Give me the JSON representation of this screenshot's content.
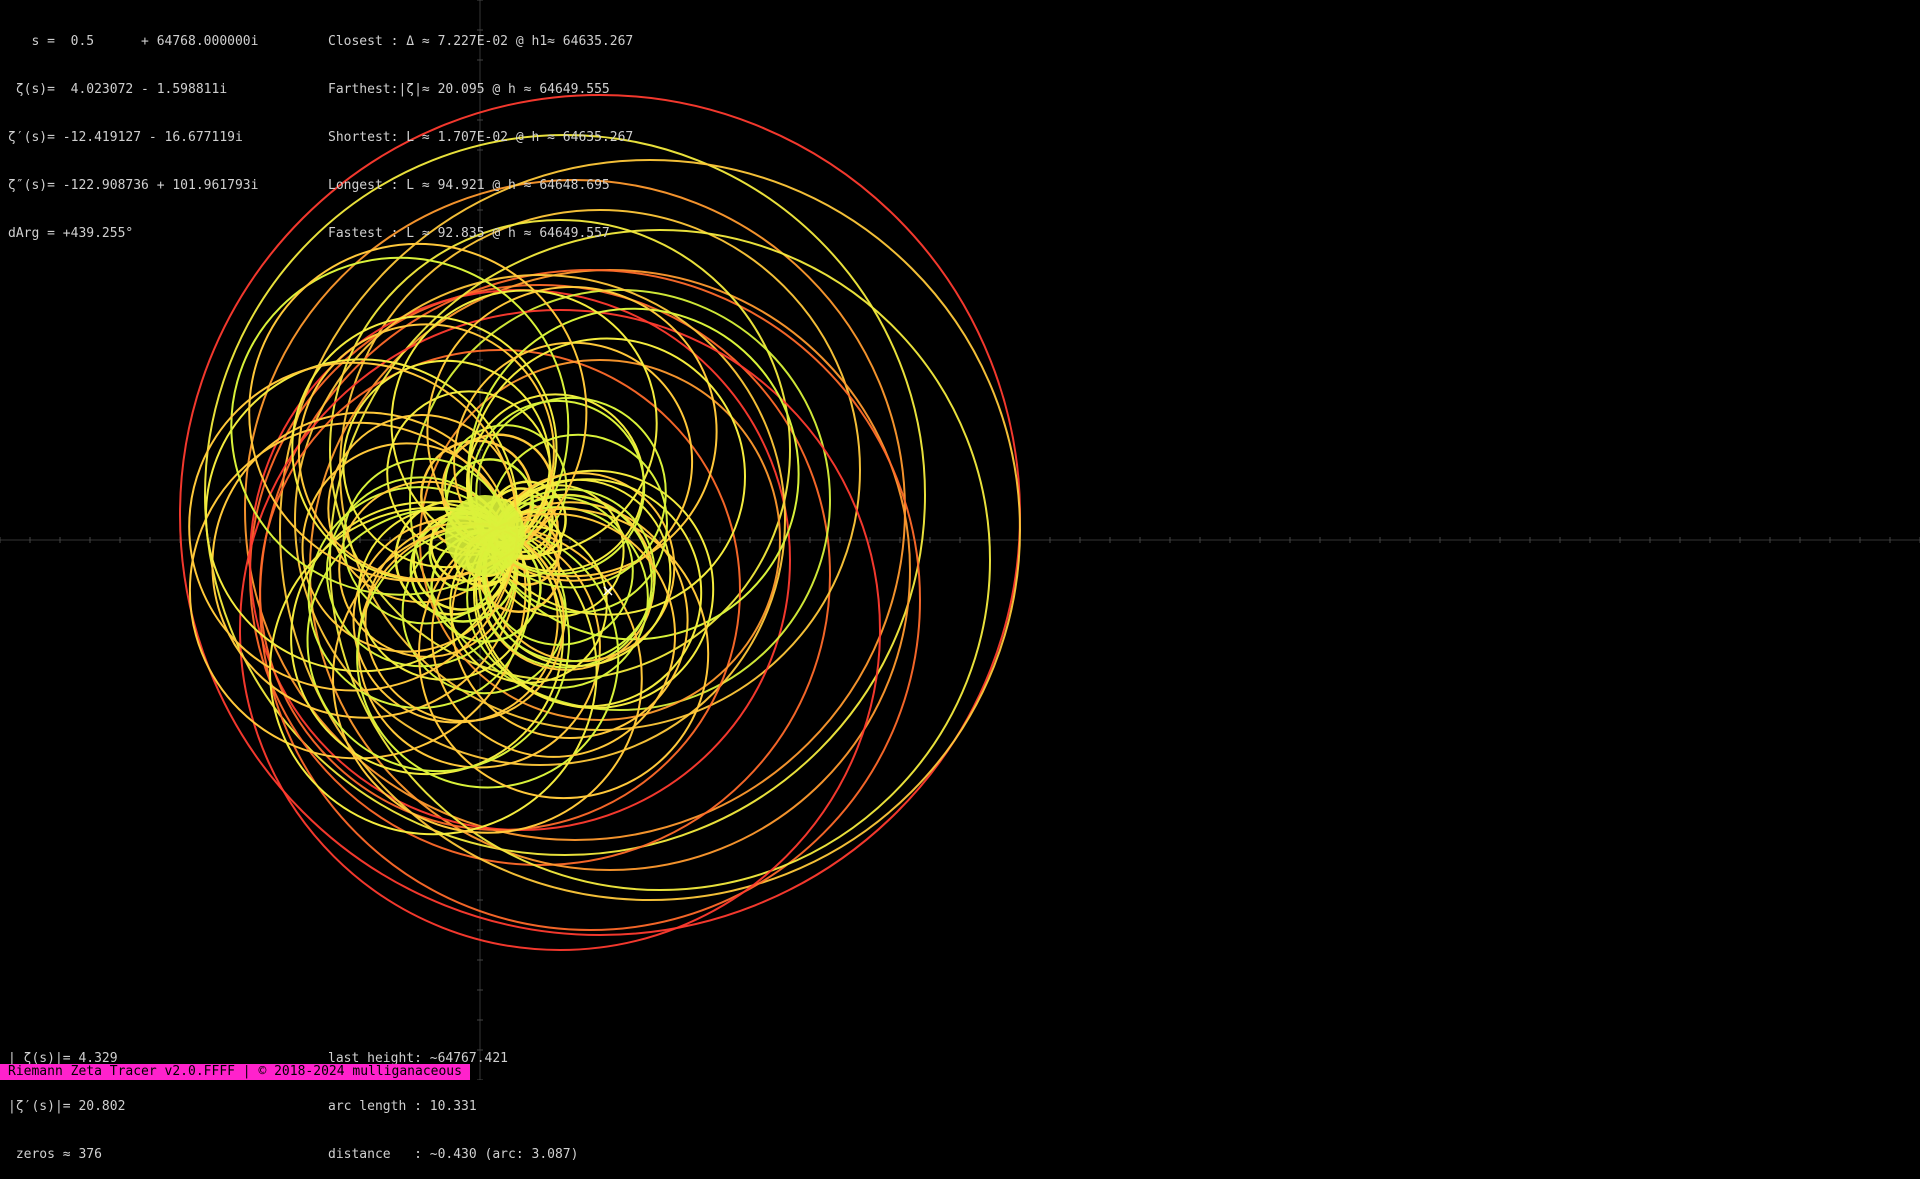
{
  "top_left": [
    "   s =  0.5      + 64768.000000i",
    " ζ(s)=  4.023072 - 1.598811i",
    "ζ′(s)= -12.419127 - 16.677119i",
    "ζ″(s)= -122.908736 + 101.961793i",
    "dArg = +439.255°"
  ],
  "top_middle": [
    "Closest : Δ ≈ 7.227E-02 @ h1≈ 64635.267",
    "Farthest:|ζ|≈ 20.095 @ h ≈ 64649.555",
    "Shortest: L ≈ 1.707E-02 @ h ≈ 64635.267",
    "Longest : L ≈ 94.921 @ h ≈ 64648.695",
    "Fastest : L ≈ 92.835 @ h ≈ 64649.557"
  ],
  "bottom_left": [
    "| ζ(s)|= 4.329",
    "|ζ′(s)|= 20.802",
    " zeros ≈ 376"
  ],
  "bottom_middle": [
    "last height: ~64767.421",
    "arc length : 10.331",
    "distance   : ~0.430 (arc: 3.087)"
  ],
  "footer": "Riemann Zeta Tracer v2.0.FFFF | © 2018-2024 mulliganaceous",
  "colors": {
    "background": "#000000",
    "text": "#d0d0d0",
    "footer_bg": "#ff22cc",
    "trace_palette": [
      "#ff3b2f",
      "#ff6a2a",
      "#ff9a2e",
      "#ffc83a",
      "#f4ec3e",
      "#d9f23a"
    ]
  },
  "current_marker": "×"
}
